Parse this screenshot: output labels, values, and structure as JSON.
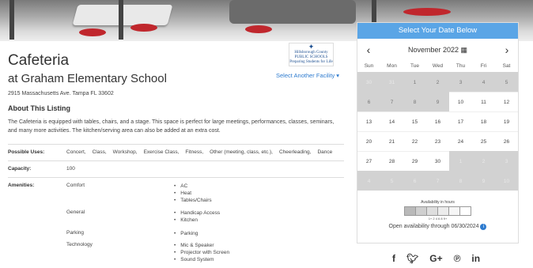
{
  "header": {
    "title": "Cafeteria",
    "subtitle": "at Graham Elementary School",
    "select_link": "Select Another Facility",
    "address": "2915 Massachusetts Ave. Tampa FL 33602",
    "logo": {
      "line1": "Hillsborough County",
      "line2": "PUBLIC SCHOOLS",
      "line3": "Preparing Students for Life"
    }
  },
  "about": {
    "heading": "About This Listing",
    "description": "The Cafeteria is equipped with tables, chairs, and a stage. This space is perfect for large meetings, performances, classes, seminars, and many more activities. The kitchen/serving area can also be added at an extra cost."
  },
  "details": {
    "uses_label": "Possible Uses:",
    "uses": [
      "Concert,",
      "Class,",
      "Workshop,",
      "Exercise Class,",
      "Fitness,",
      "Other (meeting, class, etc.),",
      "Cheerleading,",
      "Dance"
    ],
    "capacity_label": "Capacity:",
    "capacity": "100",
    "amenities_label": "Amenities:",
    "amenities": [
      {
        "category": "Comfort",
        "items": [
          "AC",
          "Heat",
          "Tables/Chairs"
        ]
      },
      {
        "category": "General",
        "items": [
          "Handicap Access",
          "Kitchen"
        ]
      },
      {
        "category": "Parking",
        "items": [
          "Parking"
        ]
      },
      {
        "category": "Technology",
        "items": [
          "Mic & Speaker",
          "Projector with Screen",
          "Sound System"
        ]
      }
    ]
  },
  "calendar": {
    "header": "Select Your Date Below",
    "month": "November 2022",
    "prev": "‹",
    "next": "›",
    "dow": [
      "Sun",
      "Mon",
      "Tue",
      "Wed",
      "Thu",
      "Fri",
      "Sat"
    ],
    "weeks": [
      [
        {
          "d": "30",
          "s": "off"
        },
        {
          "d": "31",
          "s": "off"
        },
        {
          "d": "1",
          "s": "past"
        },
        {
          "d": "2",
          "s": "past"
        },
        {
          "d": "3",
          "s": "past"
        },
        {
          "d": "4",
          "s": "past"
        },
        {
          "d": "5",
          "s": "past"
        }
      ],
      [
        {
          "d": "6",
          "s": "past"
        },
        {
          "d": "7",
          "s": "past"
        },
        {
          "d": "8",
          "s": "past"
        },
        {
          "d": "9",
          "s": "past"
        },
        {
          "d": "10",
          "s": ""
        },
        {
          "d": "11",
          "s": ""
        },
        {
          "d": "12",
          "s": ""
        }
      ],
      [
        {
          "d": "13",
          "s": ""
        },
        {
          "d": "14",
          "s": ""
        },
        {
          "d": "15",
          "s": ""
        },
        {
          "d": "16",
          "s": ""
        },
        {
          "d": "17",
          "s": ""
        },
        {
          "d": "18",
          "s": ""
        },
        {
          "d": "19",
          "s": ""
        }
      ],
      [
        {
          "d": "20",
          "s": ""
        },
        {
          "d": "21",
          "s": ""
        },
        {
          "d": "22",
          "s": ""
        },
        {
          "d": "23",
          "s": ""
        },
        {
          "d": "24",
          "s": ""
        },
        {
          "d": "25",
          "s": ""
        },
        {
          "d": "26",
          "s": ""
        }
      ],
      [
        {
          "d": "27",
          "s": ""
        },
        {
          "d": "28",
          "s": ""
        },
        {
          "d": "29",
          "s": ""
        },
        {
          "d": "30",
          "s": ""
        },
        {
          "d": "1",
          "s": "off"
        },
        {
          "d": "2",
          "s": "off"
        },
        {
          "d": "3",
          "s": "off"
        }
      ],
      [
        {
          "d": "4",
          "s": "off"
        },
        {
          "d": "5",
          "s": "off"
        },
        {
          "d": "6",
          "s": "off"
        },
        {
          "d": "7",
          "s": "off"
        },
        {
          "d": "8",
          "s": "off"
        },
        {
          "d": "9",
          "s": "off"
        },
        {
          "d": "10",
          "s": "off"
        }
      ]
    ],
    "legend_title": "Availability in hours",
    "legend_scale": "1+ 2 4 6 8 9+",
    "availability_note": "Open availability through 06/30/2024",
    "info_icon": "i"
  },
  "social": [
    "f",
    "t",
    "G+",
    "p",
    "in"
  ],
  "colors": {
    "accent": "#5aa5e6",
    "link": "#2e7bcf",
    "disabled_day": "#d2d2d2"
  }
}
